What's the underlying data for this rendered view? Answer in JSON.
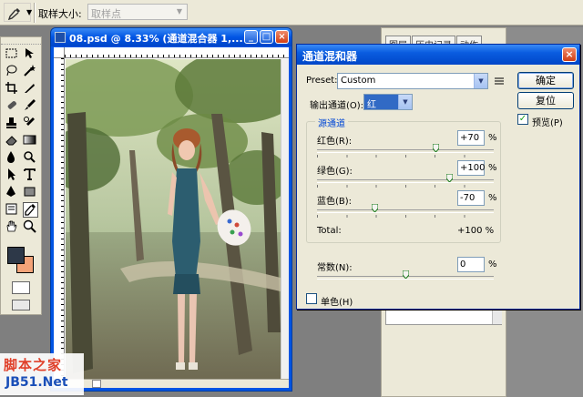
{
  "options_bar": {
    "sample_size_label": "取样大小:",
    "sample_size_value": "取样点"
  },
  "document": {
    "title": "08.psd @ 8.33% (通道混合器 1,..."
  },
  "panels": {
    "tabs": [
      "图层",
      "历史记录",
      "动作"
    ]
  },
  "colors": {
    "foreground": "#2d3848",
    "background": "#f4a378",
    "titlebar": "#0054e3",
    "dialog_bg": "#ece9d8"
  },
  "dialog": {
    "title": "通道混和器",
    "preset_label": "Preset:",
    "preset_value": "Custom",
    "output_label": "输出通道(O):",
    "output_value": "红",
    "ok_label": "确定",
    "reset_label": "复位",
    "preview_label": "预览(P)",
    "preview_checked": true,
    "source_label": "源通道",
    "channels": [
      {
        "label": "红色(R):",
        "value": "+70",
        "unit": "%",
        "level": 70
      },
      {
        "label": "绿色(G):",
        "value": "+100",
        "unit": "%",
        "level": 100
      },
      {
        "label": "蓝色(B):",
        "value": "-70",
        "unit": "%",
        "level": -70
      }
    ],
    "total_label": "Total:",
    "total_value": "+100 %",
    "constant_label": "常数(N):",
    "constant_value": "0",
    "constant_unit": "%",
    "constant_level": 0,
    "monochrome_label": "单色(H)",
    "monochrome_checked": false
  },
  "watermark": {
    "line1": "脚本之家",
    "line2": "JB51.Net"
  }
}
